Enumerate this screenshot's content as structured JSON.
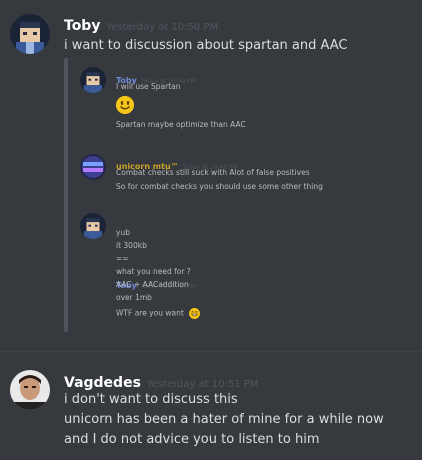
{
  "messages": [
    {
      "username": "Toby",
      "timestamp": "Yesterday at 10:50 PM",
      "lines": [
        "i want to discussion about spartan and AAC"
      ]
    },
    {
      "username": "Vagdedes",
      "timestamp": "Yesterday at 10:51 PM",
      "lines": [
        "i don't want to discuss this",
        "unicorn has been a hater of mine for a while now",
        "and I do not advice you to listen to him"
      ]
    }
  ],
  "quote": {
    "blocks": [
      {
        "username": "Toby",
        "timestamp": "Today at 10:39 PM",
        "lines": [
          "I will use Spartan",
          "Spartan maybe optimize than AAC"
        ],
        "emoji": "smiley-emoji"
      },
      {
        "username": "unicorn mtu™",
        "timestamp": "Today at 10:40 PM",
        "avatar_text": "Unicorn Leaks",
        "lines": [
          "Combat checks still suck with Alot of false positives",
          "So for combat checks you should use some other thing"
        ]
      },
      {
        "username": "Toby",
        "timestamp": "Today at 10:40 PM",
        "lines": [
          "yub",
          "it 300kb",
          "==",
          "what you need for ?",
          "AAC + AACaddition",
          "over 1mb",
          "WTF are you want"
        ],
        "emoji": "grin-emoji"
      }
    ]
  },
  "colors": {
    "background": "#36393e",
    "username": "#ffffff",
    "timestamp": "#52565d",
    "quote_name": "#7289da",
    "unicorn_name": "#c9a227"
  }
}
